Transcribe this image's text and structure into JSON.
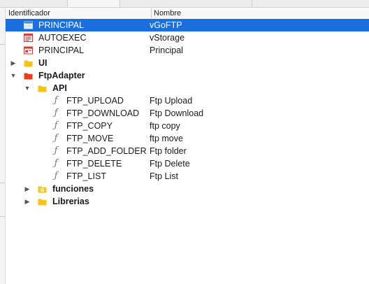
{
  "columns": {
    "id": "Identificador",
    "name": "Nombre"
  },
  "rows": [
    {
      "id": "PRINCIPAL",
      "name": "vGoFTP",
      "icon": "window-icon",
      "selected": true
    },
    {
      "id": "AUTOEXEC",
      "name": "vStorage",
      "icon": "autoexec-icon"
    },
    {
      "id": "PRINCIPAL",
      "name": "Principal",
      "icon": "window-red-icon"
    },
    {
      "id": "UI",
      "icon": "folder-yellow-icon",
      "expanded": false
    },
    {
      "id": "FtpAdapter",
      "icon": "folder-red-icon",
      "expanded": true
    },
    {
      "id": "API",
      "icon": "folder-yellow-icon",
      "expanded": true
    },
    {
      "id": "FTP_UPLOAD",
      "name": "Ftp Upload",
      "icon": "function-icon"
    },
    {
      "id": "FTP_DOWNLOAD",
      "name": "Ftp Download",
      "icon": "function-icon"
    },
    {
      "id": "FTP_COPY",
      "name": "ftp copy",
      "icon": "function-icon"
    },
    {
      "id": "FTP_MOVE",
      "name": "ftp move",
      "icon": "function-icon"
    },
    {
      "id": "FTP_ADD_FOLDER",
      "name": "Ftp folder",
      "icon": "function-icon"
    },
    {
      "id": "FTP_DELETE",
      "name": "Ftp Delete",
      "icon": "function-icon"
    },
    {
      "id": "FTP_LIST",
      "name": "Ftp List",
      "icon": "function-icon"
    },
    {
      "id": "funciones",
      "icon": "folder-gear-icon",
      "expanded": false
    },
    {
      "id": "Librerias",
      "icon": "folder-yellow-icon",
      "expanded": false
    }
  ],
  "icons": {
    "function_glyph": "ƒ"
  },
  "colors": {
    "selection": "#1a6ede",
    "folder_yellow": "#f7c21a",
    "folder_red": "#e8401e",
    "window_blue": "#3b8dd8",
    "window_red": "#d83a3a"
  }
}
